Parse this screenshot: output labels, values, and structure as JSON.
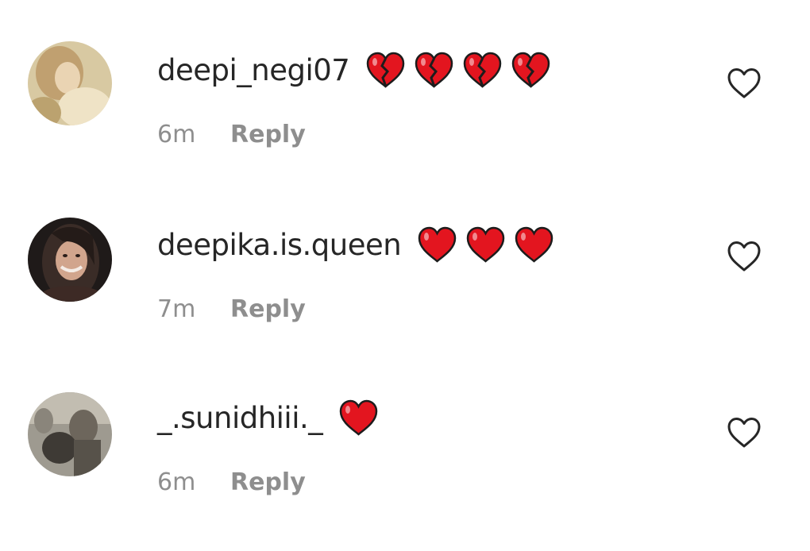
{
  "comments": [
    {
      "username": "deepi_negi07",
      "emoji": "broken-heart",
      "emoji_count": 4,
      "time": "6m",
      "reply_label": "Reply",
      "avatar_palette": [
        "#cdb68a",
        "#e8d8b4",
        "#a98e62"
      ]
    },
    {
      "username": "deepika.is.queen",
      "emoji": "red-heart",
      "emoji_count": 3,
      "time": "7m",
      "reply_label": "Reply",
      "avatar_palette": [
        "#2b2422",
        "#c69a83",
        "#e8c3ae"
      ]
    },
    {
      "username": "_.sunidhiii._",
      "emoji": "red-heart",
      "emoji_count": 1,
      "time": "6m",
      "reply_label": "Reply",
      "avatar_palette": [
        "#7d7a72",
        "#b5b0a5",
        "#3f3b36"
      ]
    }
  ],
  "colors": {
    "text": "#262626",
    "secondary": "#8e8e8e",
    "heart_red": "#e3151f",
    "heart_outline": "#1c1c1c",
    "icon": "#262626"
  }
}
